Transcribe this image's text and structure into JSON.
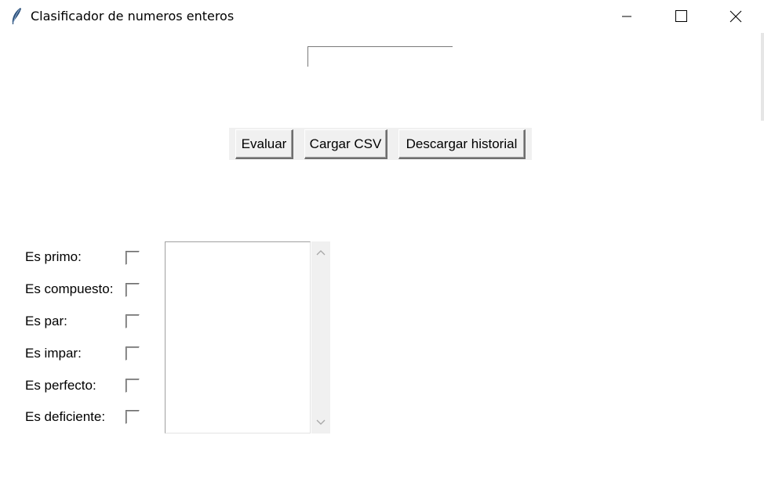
{
  "window": {
    "title": "Clasificador de numeros enteros",
    "icon": "feather-icon",
    "controls": [
      "minimize-icon",
      "maximize-icon",
      "close-icon"
    ]
  },
  "input": {
    "value": ""
  },
  "buttons": {
    "evaluate": "Evaluar",
    "load_csv": "Cargar CSV",
    "download_history": "Descargar historial"
  },
  "checks": [
    {
      "label": "Es primo:",
      "checked": false
    },
    {
      "label": "Es compuesto:",
      "checked": false
    },
    {
      "label": "Es par:",
      "checked": false
    },
    {
      "label": "Es impar:",
      "checked": false
    },
    {
      "label": "Es perfecto:",
      "checked": false
    },
    {
      "label": "Es deficiente:",
      "checked": false
    }
  ],
  "history_list": {
    "items": []
  },
  "colors": {
    "background": "#ffffff",
    "button_face": "#f0f0f0",
    "icon_feather": "#2a4f7a"
  }
}
